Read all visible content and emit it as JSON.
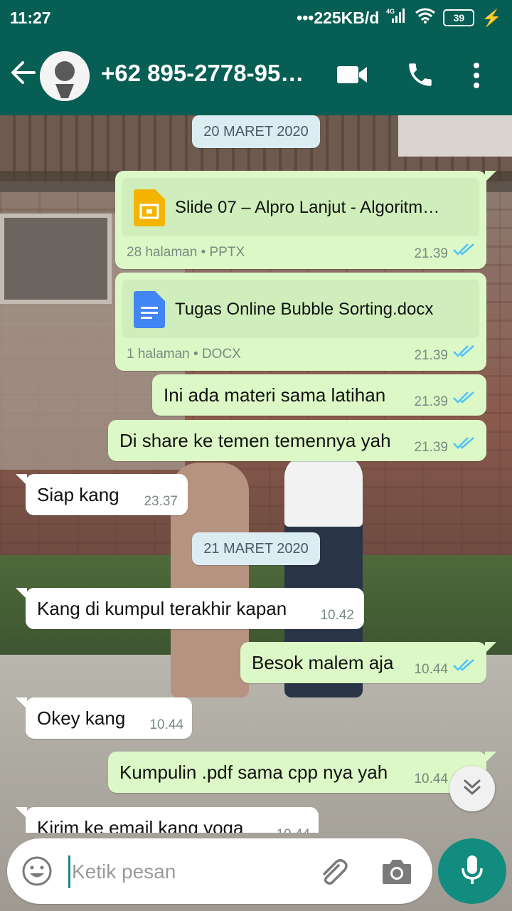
{
  "status_bar": {
    "time": "11:27",
    "network_speed": "225KB/d",
    "network_type": "4G",
    "battery": "39"
  },
  "header": {
    "contact_name": "+62 895-2778-95…",
    "icons": [
      "back-arrow-icon",
      "contact-avatar",
      "video-call-icon",
      "phone-call-icon",
      "more-options-icon"
    ]
  },
  "chat": {
    "date_1": "20 MARET 2020",
    "doc1": {
      "name": "Slide 07 – Alpro Lanjut - Algoritm…",
      "meta": "28 halaman • PPTX",
      "time": "21.39",
      "status": "read"
    },
    "doc2": {
      "name": "Tugas Online Bubble Sorting.docx",
      "meta": "1 halaman • DOCX",
      "time": "21.39",
      "status": "read"
    },
    "msg1": {
      "text": "Ini ada materi sama latihan",
      "time": "21.39"
    },
    "msg2": {
      "text": "Di share ke temen temennya yah",
      "time": "21.39"
    },
    "msg3": {
      "text": "Siap kang",
      "time": "23.37"
    },
    "date_2": "21 MARET 2020",
    "msg4": {
      "text": "Kang di kumpul terakhir kapan",
      "time": "10.42"
    },
    "msg5": {
      "text": "Besok malem aja",
      "time": "10.44"
    },
    "msg6": {
      "text": "Okey kang",
      "time": "10.44"
    },
    "msg7": {
      "text": "Kumpulin .pdf sama cpp nya yah",
      "time": "10.44"
    },
    "msg8": {
      "text": "Kirim ke email kang yoga",
      "time": "10.44"
    }
  },
  "input": {
    "placeholder": "Ketik pesan"
  },
  "colors": {
    "header": "#075e54",
    "outgoing_bubble": "#dcf8c6",
    "incoming_bubble": "#ffffff",
    "read_ticks": "#4fc3f7",
    "accent": "#128c7e"
  }
}
